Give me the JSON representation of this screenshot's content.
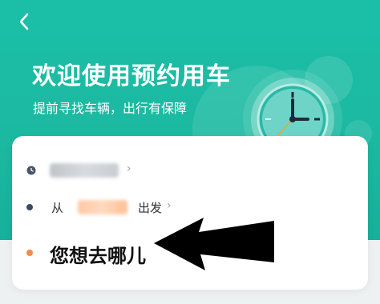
{
  "header": {
    "title": "欢迎使用预约用车",
    "subtitle": "提前寻找车辆，出行有保障"
  },
  "icons": {
    "back": "chevron-left-icon",
    "clock": "clock-illustration-icon",
    "time": "clock-small-icon"
  },
  "trip": {
    "time_chevron": "›",
    "from_prefix": "从",
    "from_suffix": "出发",
    "from_chevron": "›",
    "destination_prompt": "您想去哪儿"
  },
  "colors": {
    "header": "#1bbfa7",
    "accent_orange": "#f58b45",
    "from_dot": "#3c4a5e",
    "time_icon": "#4a5568"
  }
}
